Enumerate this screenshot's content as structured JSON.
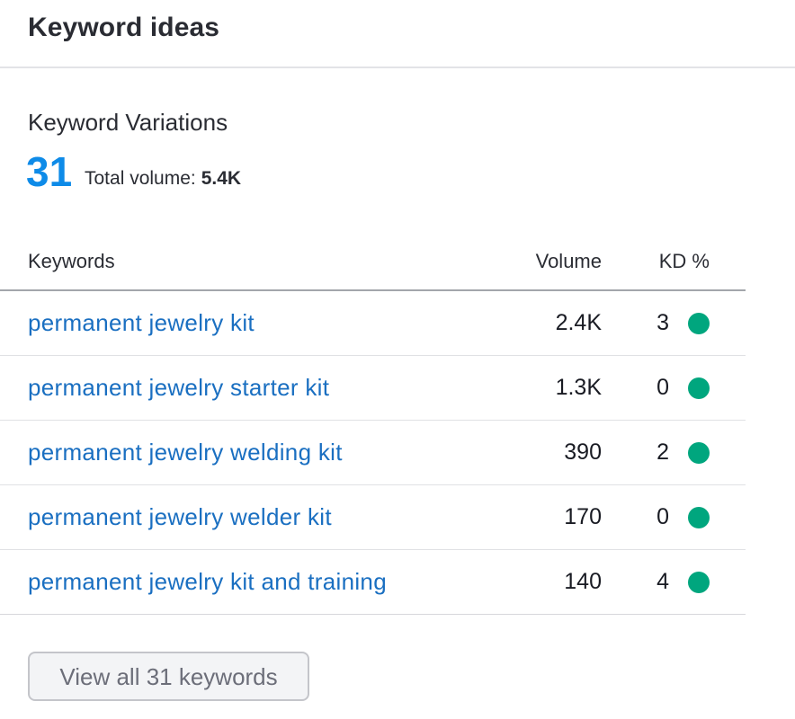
{
  "header": {
    "title": "Keyword ideas"
  },
  "variations": {
    "label": "Keyword Variations",
    "count": "31",
    "total_volume_label": "Total volume:",
    "total_volume_value": "5.4K"
  },
  "table": {
    "columns": {
      "keyword": "Keywords",
      "volume": "Volume",
      "kd": "KD %"
    },
    "rows": [
      {
        "keyword": "permanent jewelry kit",
        "volume": "2.4K",
        "kd": "3",
        "kd_color": "#00a67e"
      },
      {
        "keyword": "permanent jewelry starter kit",
        "volume": "1.3K",
        "kd": "0",
        "kd_color": "#00a67e"
      },
      {
        "keyword": "permanent jewelry welding kit",
        "volume": "390",
        "kd": "2",
        "kd_color": "#00a67e"
      },
      {
        "keyword": "permanent jewelry welder kit",
        "volume": "170",
        "kd": "0",
        "kd_color": "#00a67e"
      },
      {
        "keyword": "permanent jewelry kit and training",
        "volume": "140",
        "kd": "4",
        "kd_color": "#00a67e"
      }
    ]
  },
  "footer": {
    "view_all_label": "View all 31 keywords"
  },
  "colors": {
    "accent_count": "#0e8be8",
    "link": "#1a6fc1",
    "kd_easy": "#00a67e"
  }
}
